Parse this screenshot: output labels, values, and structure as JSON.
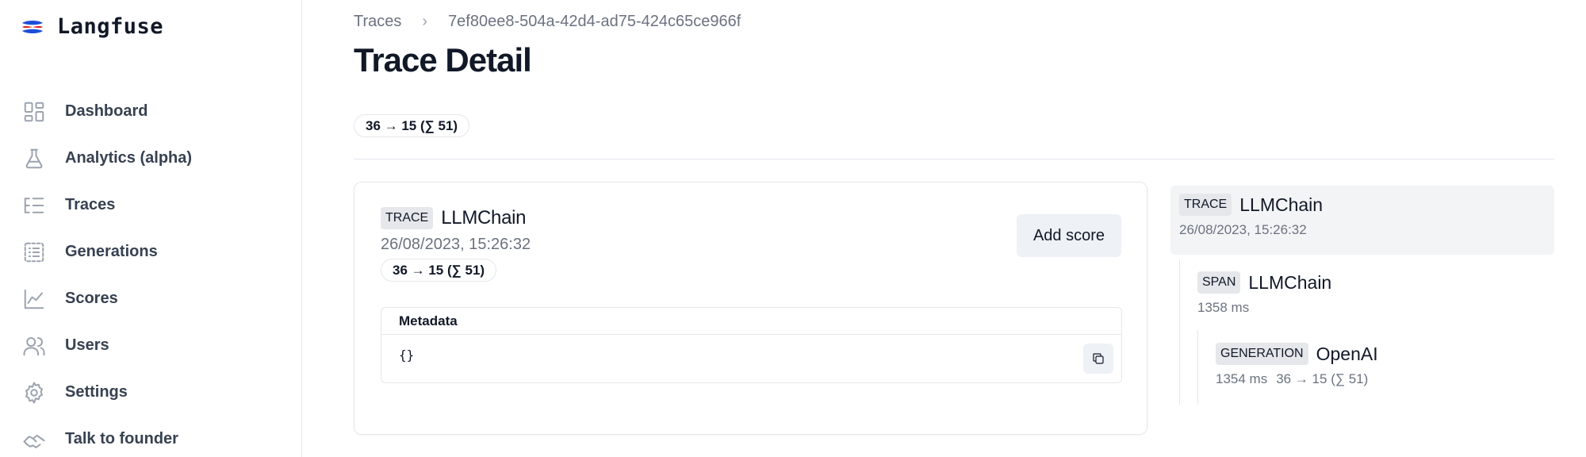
{
  "app": {
    "name": "Langfuse"
  },
  "sidebar": {
    "items": [
      {
        "label": "Dashboard",
        "icon": "dashboard-icon"
      },
      {
        "label": "Analytics (alpha)",
        "icon": "flask-icon"
      },
      {
        "label": "Traces",
        "icon": "list-tree-icon"
      },
      {
        "label": "Generations",
        "icon": "list-box-icon"
      },
      {
        "label": "Scores",
        "icon": "line-chart-icon"
      },
      {
        "label": "Users",
        "icon": "users-icon"
      },
      {
        "label": "Settings",
        "icon": "gear-icon"
      },
      {
        "label": "Talk to founder",
        "icon": "handshake-icon"
      }
    ]
  },
  "breadcrumb": {
    "parent": "Traces",
    "separator": "›",
    "current": "7ef80ee8-504a-42d4-ad75-424c65ce966f"
  },
  "page": {
    "title": "Trace Detail",
    "usage_pill": "36 → 15 (∑ 51)"
  },
  "trace_card": {
    "type": "TRACE",
    "name": "LLMChain",
    "timestamp": "26/08/2023, 15:26:32",
    "usage_pill": "36 → 15 (∑ 51)",
    "add_score_label": "Add score",
    "metadata": {
      "header": "Metadata",
      "value": "{}"
    }
  },
  "tree": {
    "root": {
      "type": "TRACE",
      "name": "LLMChain",
      "timestamp": "26/08/2023, 15:26:32"
    },
    "span": {
      "type": "SPAN",
      "name": "LLMChain",
      "duration": "1358 ms"
    },
    "generation": {
      "type": "GENERATION",
      "name": "OpenAI",
      "duration": "1354 ms",
      "usage": "36 → 15 (∑ 51)"
    }
  }
}
